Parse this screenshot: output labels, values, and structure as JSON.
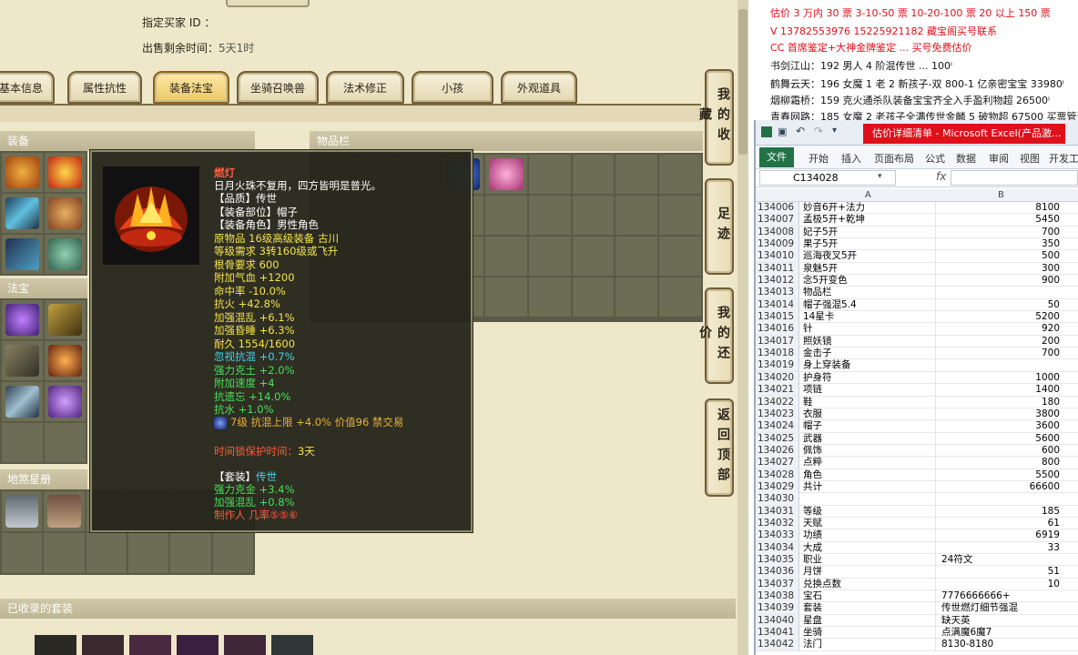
{
  "game": {
    "buyer_label": "指定买家 ID ：",
    "time_left_label": "出售剩余时间：",
    "time_left_value": "5天1时",
    "tabs": [
      "基本信息",
      "属性抗性",
      "装备法宝",
      "坐骑召唤兽",
      "法术修正",
      "小孩",
      "外观道具"
    ],
    "active_tab": "装备法宝",
    "sections": {
      "equipment": "装备",
      "treasure": "法宝",
      "stars": "地煞星册",
      "inventory": "物品栏",
      "collected_sets": "已收录的套装"
    },
    "side_buttons": [
      "我的收藏",
      "足迹",
      "我的还价",
      "返回顶部"
    ],
    "tooltip": {
      "name": "燃灯",
      "desc": "日月火珠不复用，四方皆明是普光。",
      "lines": [
        {
          "text": "【品质】传世",
          "color": "w"
        },
        {
          "text": "【装备部位】帽子",
          "color": "w"
        },
        {
          "text": "【装备角色】男性角色",
          "color": "w"
        },
        {
          "text": "原物品 16级高级装备 古川",
          "color": "y"
        },
        {
          "text": "等级需求 3转160级或飞升",
          "color": "y"
        },
        {
          "text": "根骨要求 600",
          "color": "y"
        },
        {
          "text": "附加气血 +1200",
          "color": "y"
        },
        {
          "text": "命中率 -10.0%",
          "color": "y"
        },
        {
          "text": "抗火 +42.8%",
          "color": "y"
        },
        {
          "text": "加强混乱 +6.1%",
          "color": "y"
        },
        {
          "text": "加强昏睡 +6.3%",
          "color": "y"
        },
        {
          "text": "耐久 1554/1600",
          "color": "y"
        },
        {
          "text": "忽视抗混 +0.7%",
          "color": "c"
        },
        {
          "text": "强力克土 +2.0%",
          "color": "g"
        },
        {
          "text": "附加速度 +4",
          "color": "g"
        },
        {
          "text": "抗遗忘 +14.0%",
          "color": "g"
        },
        {
          "text": "抗水 +1.0%",
          "color": "g"
        }
      ],
      "gem_line": "7级 抗混上限 +4.0% 价值96 禁交易",
      "protect_label": "时间锁保护时间：",
      "protect_value": "3天",
      "set_label": "【套装】",
      "set_value": "传世",
      "set_lines": [
        "强力克金 +3.4%",
        "加强混乱 +0.8%"
      ],
      "maker": "制作人 几率⑤⑤⑥"
    }
  },
  "ads": [
    {
      "text": "估价 3 万内 30 票    3-10-50 票    10-20-100 票    20 以上 150 票",
      "color": "#e0101a"
    },
    {
      "text": "V 13782553976    15225921182   藏宝阁买号联系",
      "color": "#e0101a"
    },
    {
      "text": "CC 首席鉴定+大神金牌鉴定 ... 买号免费估价",
      "color": "#e0101a"
    },
    {
      "text": "书剑江山：192 男人 4 阶混传世 ... 100ⁱ",
      "color": "#111"
    },
    {
      "text": "鹤舞云天：196 女魔 1 老 2 新孩子-双 800-1 亿亲密宝宝 33980ⁱ",
      "color": "#111"
    },
    {
      "text": "烟柳霜桥：159 克火通杀队装备宝宝齐全入手盈利物超 26500ⁱ",
      "color": "#111"
    },
    {
      "text": "青春网路：185 女魔 2 老孩子全满传世金麟 5 破物超 67500 买票管退",
      "color": "#111"
    }
  ],
  "excel": {
    "title": "估价详细清单 - Microsoft Excel(产品激...",
    "file_tab": "文件",
    "ribbon_tabs": [
      "开始",
      "插入",
      "页面布局",
      "公式",
      "数据",
      "审阅",
      "视图",
      "开发工"
    ],
    "name_box": "C134028",
    "fx": "fx",
    "col_a": "A",
    "col_b": "B",
    "rows": [
      [
        "134006",
        "妙音6开+法力",
        "8100"
      ],
      [
        "134007",
        "孟极5开+乾坤",
        "5450"
      ],
      [
        "134008",
        "妃子5开",
        "700"
      ],
      [
        "134009",
        "果子5开",
        "350"
      ],
      [
        "134010",
        "巡海夜叉5开",
        "500"
      ],
      [
        "134011",
        "泉魅5开",
        "300"
      ],
      [
        "134012",
        "念5开变色",
        "900"
      ],
      [
        "134013",
        "物品栏",
        ""
      ],
      [
        "134014",
        "帽子强混5.4",
        "50"
      ],
      [
        "134015",
        "14星卡",
        "5200"
      ],
      [
        "134016",
        "针",
        "920"
      ],
      [
        "134017",
        "照妖镜",
        "200"
      ],
      [
        "134018",
        "金击子",
        "700"
      ],
      [
        "134019",
        "身上穿装备",
        ""
      ],
      [
        "134020",
        "护身符",
        "1000"
      ],
      [
        "134021",
        "项链",
        "1400"
      ],
      [
        "134022",
        "鞋",
        "180"
      ],
      [
        "134023",
        "衣服",
        "3800"
      ],
      [
        "134024",
        "帽子",
        "3600"
      ],
      [
        "134025",
        "武器",
        "5600"
      ],
      [
        "134026",
        "佩饰",
        "600"
      ],
      [
        "134027",
        "点粹",
        "800"
      ],
      [
        "134028",
        "角色",
        "5500"
      ],
      [
        "134029",
        "共计",
        "66600"
      ],
      [
        "134030",
        "",
        ""
      ],
      [
        "134031",
        "等级",
        "185"
      ],
      [
        "134032",
        "天赋",
        "61"
      ],
      [
        "134033",
        "功绩",
        "6919"
      ],
      [
        "134034",
        "大成",
        "33"
      ],
      [
        "134035",
        "职业",
        "24符文"
      ],
      [
        "134036",
        "月饼",
        "51"
      ],
      [
        "134037",
        "兑换点数",
        "10"
      ],
      [
        "134038",
        "宝石",
        "7776666666+"
      ],
      [
        "134039",
        "套装",
        "传世燃灯细节强混"
      ],
      [
        "134040",
        "星盘",
        "缺天英"
      ],
      [
        "134041",
        "坐骑",
        "点满魔6魔7"
      ],
      [
        "134042",
        "法门",
        "8130-8180"
      ]
    ]
  }
}
